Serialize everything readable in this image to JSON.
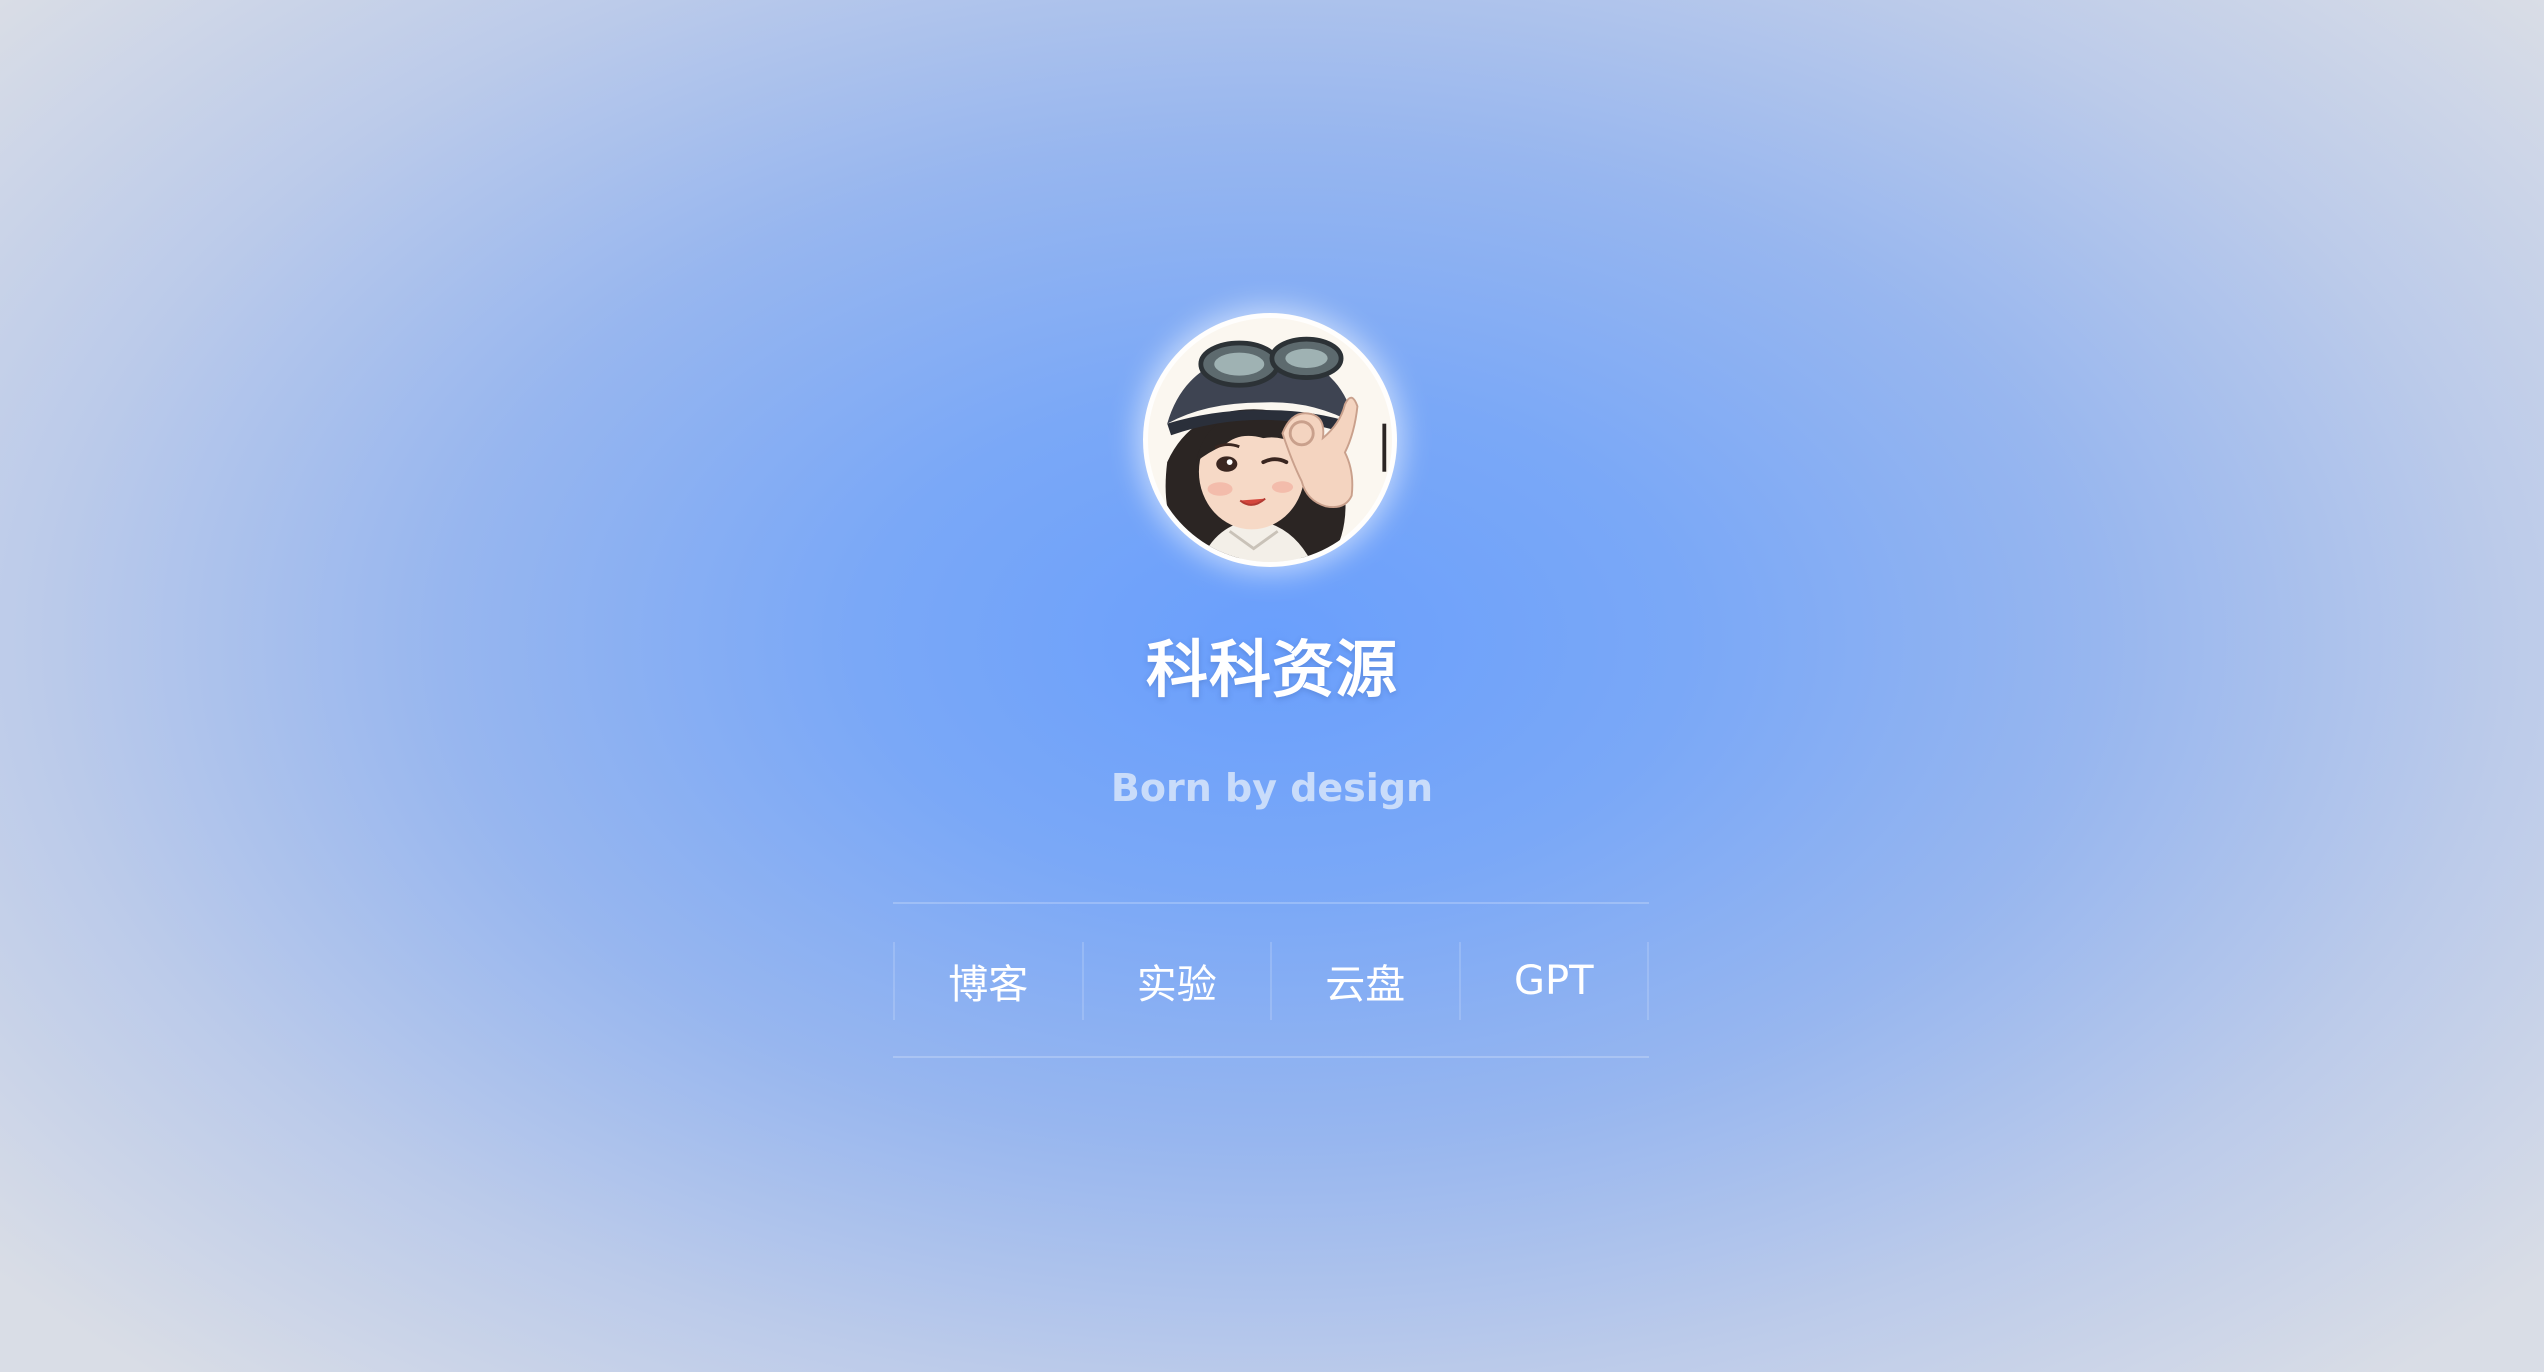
{
  "profile": {
    "avatar_icon": "avatar-girl-helmet-illustration",
    "title": "科科资源",
    "tagline": "Born by design"
  },
  "nav": {
    "items": [
      {
        "label": "博客"
      },
      {
        "label": "实验"
      },
      {
        "label": "云盘"
      },
      {
        "label": "GPT"
      }
    ]
  },
  "colors": {
    "background_center": "#6a9ffc",
    "background_edge": "#d9dde6",
    "title": "#ffffff",
    "tagline": "#c9dcfa",
    "nav_text": "#ffffff"
  }
}
